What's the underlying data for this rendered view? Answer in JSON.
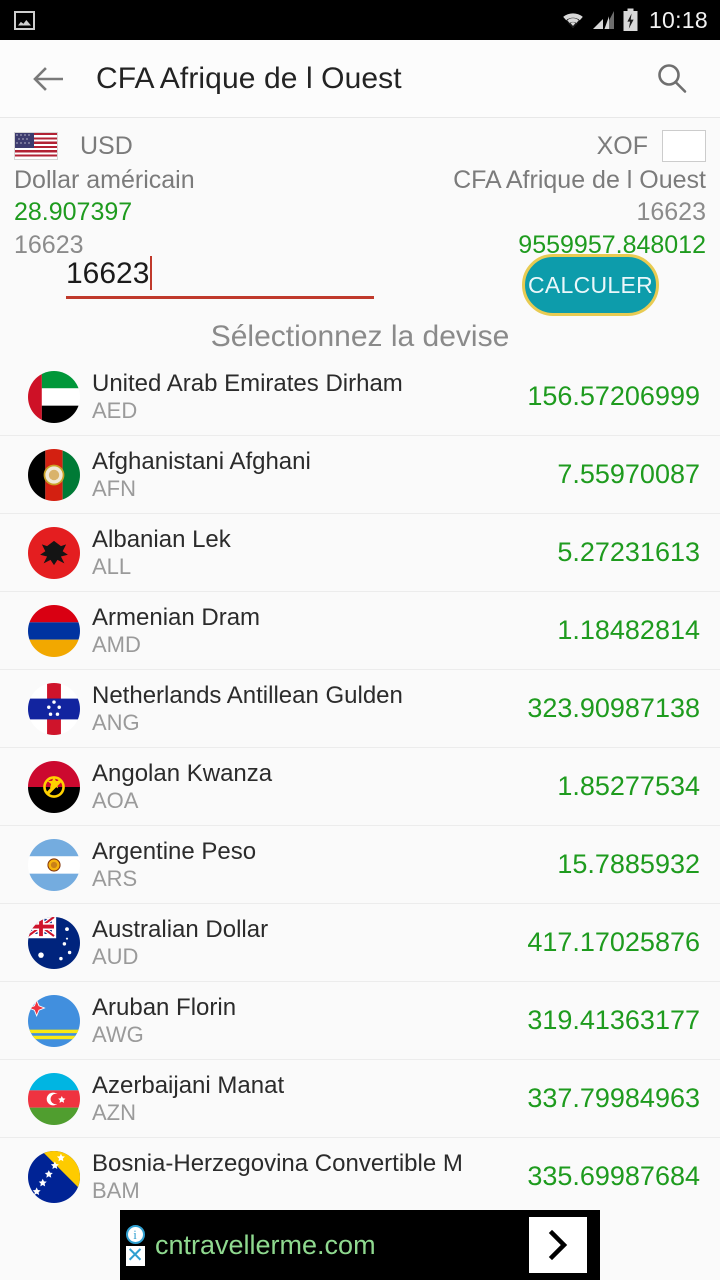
{
  "statusbar": {
    "time": "10:18",
    "icons": [
      "photo-icon",
      "wifi-icon",
      "signal-icon",
      "battery-charging-icon"
    ]
  },
  "actionbar": {
    "back_icon": "back-arrow-icon",
    "title": "CFA Afrique de l Ouest",
    "search_icon": "search-icon"
  },
  "conversion": {
    "from": {
      "flag": "us-flag",
      "code": "USD",
      "name": "Dollar américain",
      "rate": "28.907397",
      "amount": "16623"
    },
    "to": {
      "flag": "empty-flag-placeholder",
      "code": "XOF",
      "name": "CFA Afrique de l Ouest",
      "amount": "16623",
      "result": "9559957.848012"
    },
    "input_value": "16623",
    "calculate_label": "CALCULER"
  },
  "section_title": "Sélectionnez la devise",
  "currencies": [
    {
      "name": "United Arab Emirates Dirham",
      "code": "AED",
      "rate": "156.57206999",
      "flag": "ae"
    },
    {
      "name": "Afghanistani Afghani",
      "code": "AFN",
      "rate": "7.55970087",
      "flag": "af"
    },
    {
      "name": "Albanian Lek",
      "code": "ALL",
      "rate": "5.27231613",
      "flag": "al"
    },
    {
      "name": "Armenian Dram",
      "code": "AMD",
      "rate": "1.18482814",
      "flag": "am"
    },
    {
      "name": "Netherlands Antillean Gulden",
      "code": "ANG",
      "rate": "323.90987138",
      "flag": "an"
    },
    {
      "name": "Angolan Kwanza",
      "code": "AOA",
      "rate": "1.85277534",
      "flag": "ao"
    },
    {
      "name": "Argentine Peso",
      "code": "ARS",
      "rate": "15.7885932",
      "flag": "ar"
    },
    {
      "name": "Australian Dollar",
      "code": "AUD",
      "rate": "417.17025876",
      "flag": "au"
    },
    {
      "name": "Aruban Florin",
      "code": "AWG",
      "rate": "319.41363177",
      "flag": "aw"
    },
    {
      "name": "Azerbaijani Manat",
      "code": "AZN",
      "rate": "337.79984963",
      "flag": "az"
    },
    {
      "name": "Bosnia-Herzegovina Convertible M",
      "code": "BAM",
      "rate": "335.69987684",
      "flag": "ba"
    }
  ],
  "ad": {
    "info_icon": "info-icon",
    "close_icon": "close-icon",
    "url": "cntravellerme.com",
    "cta_icon": "chevron-right-icon"
  },
  "colors": {
    "green": "#1e9b1e",
    "teal": "#0d9cab",
    "gold_border": "#e8cb52",
    "underline_red": "#c0392b",
    "grey_text": "#8b8b8b"
  }
}
